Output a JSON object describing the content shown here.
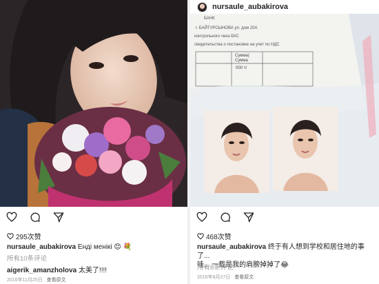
{
  "left_post": {
    "likes_count": "295次赞",
    "caption_user": "nursaule_aubakirova",
    "caption_text": "Енді менікі",
    "caption_emoji": "😊 💐",
    "view_comments": "所有10条评论",
    "comment_user": "aigerik_amanzholova",
    "comment_text": "太美了!!!!",
    "date": "2016年11月25日",
    "translate_label": "查看原文"
  },
  "right_post": {
    "header_username": "nursaule_aubakirova",
    "likes_count": "468次赞",
    "caption_user": "nursaule_aubakirova",
    "caption_text": "终于有人想到学校和居住地的事了...",
    "caption_line2": "哇... 一载是我的肩膀掉掉了😂",
    "view_comments": "所有8条评论",
    "date": "2016年8月27日",
    "translate_label": "查看原文",
    "document_text": [
      "БАНК",
      "г. БАЙТУРСЫНОВА ул. дом 20А",
      "контрольного чека БКС",
      "свидетельства о постановке на учет по НДС",
      "Сумма(",
      "Сумма",
      "000 тг"
    ]
  },
  "icons": [
    "heart-icon",
    "comment-icon",
    "share-icon"
  ]
}
